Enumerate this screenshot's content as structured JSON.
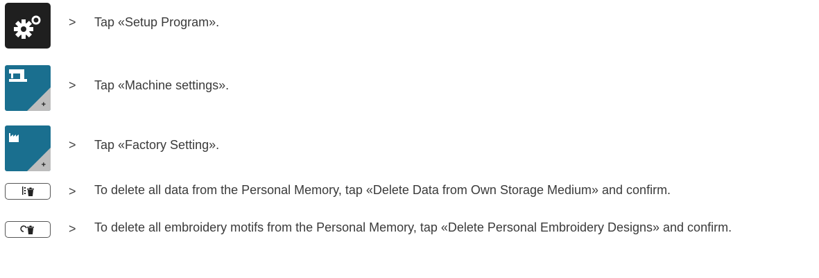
{
  "steps": [
    {
      "icon": "setup-gears-icon",
      "arrow": ">",
      "text": "Tap «Setup Program»."
    },
    {
      "icon": "machine-settings-icon",
      "arrow": ">",
      "text": "Tap «Machine settings»."
    },
    {
      "icon": "factory-setting-icon",
      "arrow": ">",
      "text": "Tap «Factory Setting»."
    },
    {
      "icon": "delete-data-icon",
      "arrow": ">",
      "text": "To delete all data from the Personal Memory, tap «Delete Data from Own Storage Medium» and confirm."
    },
    {
      "icon": "delete-embroidery-icon",
      "arrow": ">",
      "text": "To delete all embroidery motifs from the Personal Memory, tap «Delete Personal Embroidery Designs» and confirm."
    }
  ],
  "button_plus": "+",
  "colors": {
    "teal": "#1a6f8f",
    "black": "#1f1f1f",
    "grey_corner": "#bdbdbd"
  }
}
